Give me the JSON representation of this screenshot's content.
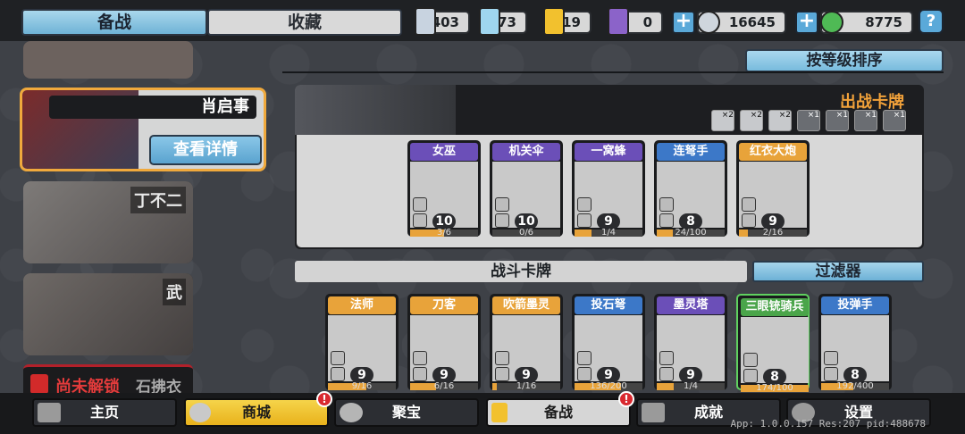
{
  "top_tabs": {
    "active": "备战",
    "inactive": "收藏"
  },
  "resources": [
    {
      "id": "silver-gem",
      "value": "403",
      "color": "#c8d3e0"
    },
    {
      "id": "crystal",
      "value": "73",
      "color": "#9fd6ef"
    },
    {
      "id": "gold-shield",
      "value": "19",
      "color": "#f2c12e"
    },
    {
      "id": "purple-token",
      "value": "0",
      "color": "#8b63c9"
    }
  ],
  "currencies": [
    {
      "id": "silver-coin",
      "plus": "+",
      "value": "16645",
      "color": "#cfd6dd"
    },
    {
      "id": "green-coin",
      "plus": "+",
      "value": "8775",
      "color": "#4fba55"
    }
  ],
  "help_label": "?",
  "heroes": [
    {
      "name": ""
    },
    {
      "name": "肖启事",
      "details": "查看详情",
      "selected": true
    },
    {
      "name": "丁不二"
    },
    {
      "name": "武"
    }
  ],
  "locked_hero": {
    "status": "尚未解锁",
    "name": "石拂衣"
  },
  "sort_button": "按等级排序",
  "deck": {
    "title": "出战卡牌",
    "slots": [
      {
        "count": "×2",
        "unlocked": true
      },
      {
        "count": "×2",
        "unlocked": true
      },
      {
        "count": "×2",
        "unlocked": true
      },
      {
        "count": "×1",
        "unlocked": false
      },
      {
        "count": "×1",
        "unlocked": false
      },
      {
        "count": "×1",
        "unlocked": false
      },
      {
        "count": "×1",
        "unlocked": false
      }
    ],
    "cards": [
      {
        "name": "女巫",
        "level": "10",
        "progress": "3/6",
        "fill": 0.5,
        "color": "#6b4fb8"
      },
      {
        "name": "机关伞",
        "level": "10",
        "progress": "0/6",
        "fill": 0.0,
        "color": "#6b4fb8"
      },
      {
        "name": "一窝蜂",
        "level": "9",
        "progress": "1/4",
        "fill": 0.25,
        "color": "#6b4fb8"
      },
      {
        "name": "连弩手",
        "level": "8",
        "progress": "24/100",
        "fill": 0.24,
        "color": "#3c78c8"
      },
      {
        "name": "红衣大炮",
        "level": "9",
        "progress": "2/16",
        "fill": 0.125,
        "color": "#e8a33a"
      }
    ]
  },
  "battle_cards": {
    "title": "战斗卡牌",
    "filter": "过滤器",
    "cards": [
      {
        "name": "法师",
        "level": "9",
        "progress": "9/16",
        "fill": 0.56,
        "color": "#e8a33a"
      },
      {
        "name": "刀客",
        "level": "9",
        "progress": "6/16",
        "fill": 0.375,
        "color": "#e8a33a"
      },
      {
        "name": "吹箭墨灵",
        "level": "9",
        "progress": "1/16",
        "fill": 0.06,
        "color": "#e8a33a"
      },
      {
        "name": "投石弩",
        "level": "9",
        "progress": "136/200",
        "fill": 0.68,
        "color": "#3c78c8"
      },
      {
        "name": "墨灵塔",
        "level": "9",
        "progress": "1/4",
        "fill": 0.25,
        "color": "#6b4fb8"
      },
      {
        "name": "三眼铳骑兵",
        "level": "8",
        "progress": "174/100",
        "fill": 1.0,
        "color": "#4aa54a",
        "upgradable": true
      },
      {
        "name": "投弹手",
        "level": "8",
        "progress": "192/400",
        "fill": 0.48,
        "color": "#3c78c8"
      }
    ]
  },
  "nav": [
    {
      "id": "home",
      "label": "主页",
      "icon": "temple-icon"
    },
    {
      "id": "shop",
      "label": "商城",
      "icon": "coins-icon",
      "badge": "!"
    },
    {
      "id": "treasure",
      "label": "聚宝",
      "icon": "bowl-icon"
    },
    {
      "id": "prep",
      "label": "备战",
      "icon": "cards-icon",
      "badge": "!"
    },
    {
      "id": "achieve",
      "label": "成就",
      "icon": "blocks-icon"
    },
    {
      "id": "settings",
      "label": "设置",
      "icon": "gear-icon"
    }
  ],
  "version": "App: 1.0.0.157 Res:207 pid:488678"
}
